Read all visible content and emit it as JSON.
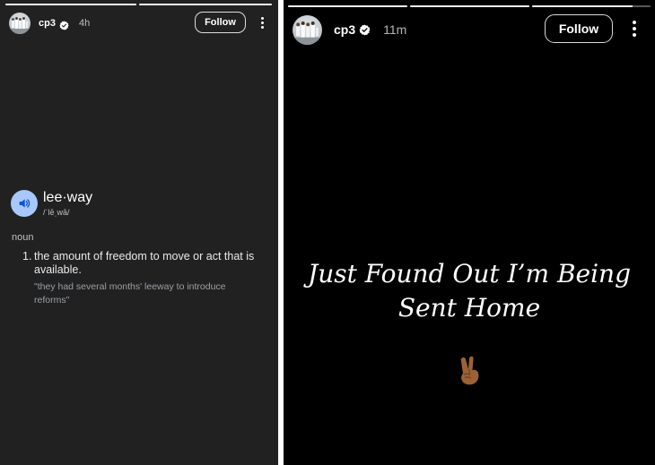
{
  "left_story": {
    "progress": [
      1,
      1
    ],
    "username": "cp3",
    "time": "4h",
    "follow_label": "Follow",
    "dictionary": {
      "word": "lee·way",
      "phonetic": "/ˈlēˌwā/",
      "part_of_speech": "noun",
      "number": "1.",
      "definition": "the amount of freedom to move or act that is available.",
      "example": "\"they had several months' leeway to introduce reforms\""
    }
  },
  "right_story": {
    "progress": [
      1,
      1,
      0.85
    ],
    "username": "cp3",
    "time": "11m",
    "follow_label": "Follow",
    "text_line1": "Just Found Out I’m Being",
    "text_line2": "Sent Home",
    "emoji": "victory-hand"
  },
  "colors": {
    "left_background": "#212121",
    "right_background": "#000000",
    "verified_badge": "#ffffff",
    "speaker_button": "#a8c7fa",
    "emoji_skin": "#9a6236"
  }
}
